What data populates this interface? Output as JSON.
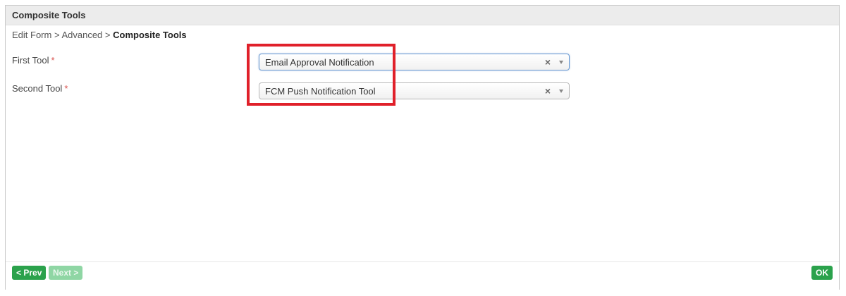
{
  "panel": {
    "title": "Composite Tools"
  },
  "breadcrumb": {
    "items": [
      "Edit Form",
      "Advanced"
    ],
    "separator": ">",
    "current": "Composite Tools"
  },
  "form": {
    "required_marker": "*",
    "first_tool": {
      "label": "First Tool",
      "value": "Email Approval Notification",
      "clear_glyph": "×"
    },
    "second_tool": {
      "label": "Second Tool",
      "value": "FCM Push Notification Tool",
      "clear_glyph": "×"
    }
  },
  "footer": {
    "prev_label": "< Prev",
    "next_label": "Next >",
    "ok_label": "OK"
  },
  "colors": {
    "highlight": "#e0202a",
    "button_green": "#2ba24c",
    "button_disabled": "#8fd6a4",
    "required": "#d9534f"
  }
}
